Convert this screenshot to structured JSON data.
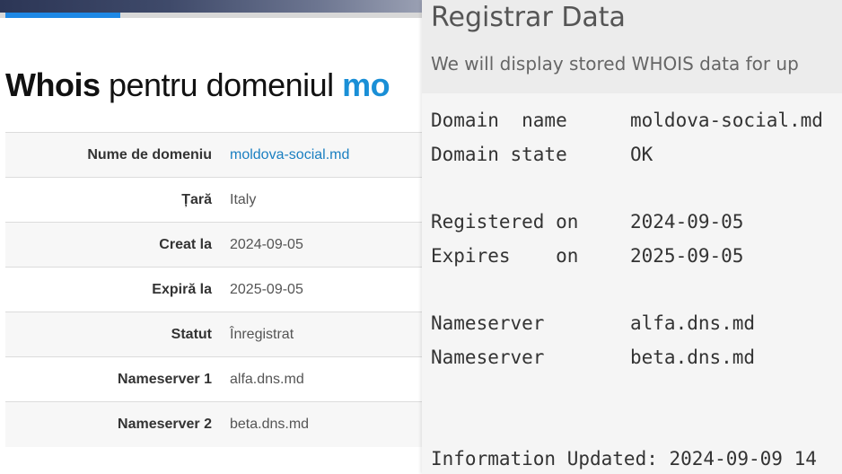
{
  "left": {
    "title_bold": "Whois",
    "title_rest": " pentru domeniul ",
    "title_domain": "mo",
    "rows": [
      {
        "label": "Nume de domeniu",
        "value": "moldova-social.md"
      },
      {
        "label": "Țară",
        "value": "Italy"
      },
      {
        "label": "Creat la",
        "value": "2024-09-05"
      },
      {
        "label": "Expiră la",
        "value": "2025-09-05"
      },
      {
        "label": "Statut",
        "value": "Înregistrat"
      },
      {
        "label": "Nameserver 1",
        "value": "alfa.dns.md"
      },
      {
        "label": "Nameserver 2",
        "value": "beta.dns.md"
      }
    ]
  },
  "right": {
    "title": "Registrar Data",
    "subtitle": "We will display stored WHOIS data for up",
    "lines": [
      {
        "label": "Domain  name",
        "value": "moldova-social.md"
      },
      {
        "label": "Domain state",
        "value": "OK"
      },
      {
        "label": "Registered on",
        "value": "2024-09-05"
      },
      {
        "label": "Expires    on",
        "value": "2025-09-05"
      },
      {
        "label": "Nameserver",
        "value": "alfa.dns.md"
      },
      {
        "label": "Nameserver",
        "value": "beta.dns.md"
      }
    ],
    "updated": "Information Updated: 2024-09-09 14"
  },
  "colors": {
    "accent_blue": "#1e88e5",
    "link_blue": "#1a7fc1",
    "domain_blue": "#1a8fd6"
  }
}
